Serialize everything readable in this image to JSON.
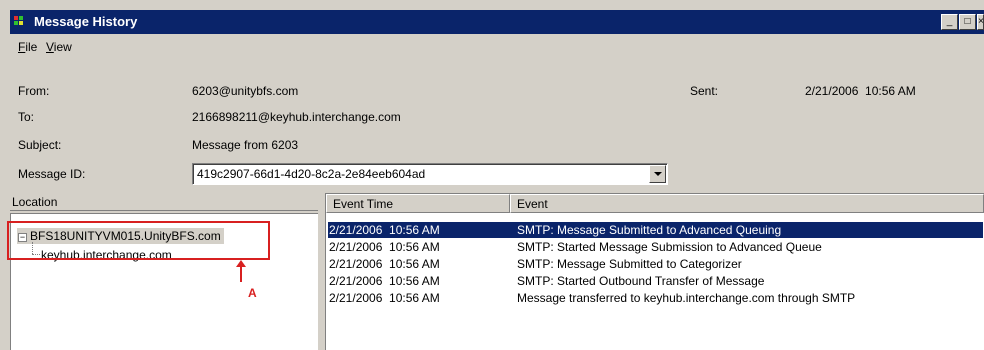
{
  "window": {
    "title": "Message History",
    "minimize_glyph": "_",
    "maximize_glyph": "□",
    "close_glyph": "×"
  },
  "menu": [
    {
      "label": "File",
      "accel": "F",
      "rest": "ile"
    },
    {
      "label": "View",
      "accel": "V",
      "rest": "iew"
    }
  ],
  "fields": {
    "from_label": "From:",
    "from_value": "6203@unitybfs.com",
    "to_label": "To:",
    "to_value": "2166898211@keyhub.interchange.com",
    "subject_label": "Subject:",
    "subject_value": "Message from 6203",
    "message_id_label": "Message ID:",
    "message_id_value": "419c2907-66d1-4d20-8c2a-2e84eeb604ad",
    "sent_label": "Sent:",
    "sent_value": "2/21/2006  10:56 AM"
  },
  "location": {
    "header": "Location",
    "root": "BFS18UNITYVM015.UnityBFS.com",
    "root_expander": "−",
    "child": "keyhub.interchange.com"
  },
  "events": {
    "columns": [
      "Event Time",
      "Event"
    ],
    "rows": [
      {
        "time": "2/21/2006  10:56 AM",
        "event": "SMTP: Message Submitted to Advanced Queuing",
        "selected": true
      },
      {
        "time": "2/21/2006  10:56 AM",
        "event": "SMTP: Started Message Submission to Advanced Queue",
        "selected": false
      },
      {
        "time": "2/21/2006  10:56 AM",
        "event": "SMTP: Message Submitted to Categorizer",
        "selected": false
      },
      {
        "time": "2/21/2006  10:56 AM",
        "event": "SMTP: Started Outbound Transfer of Message",
        "selected": false
      },
      {
        "time": "2/21/2006  10:56 AM",
        "event": "Message transferred to keyhub.interchange.com through SMTP",
        "selected": false
      }
    ]
  },
  "annotation": {
    "label": "A",
    "color": "#d82020"
  },
  "colors": {
    "titlebar": "#0a246a",
    "selection": "#0a246a",
    "chrome": "#d4d0c8"
  }
}
